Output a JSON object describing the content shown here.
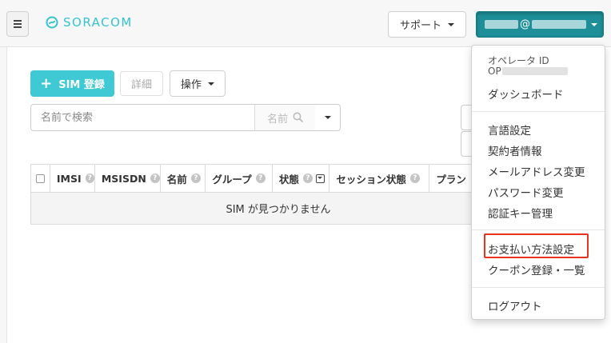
{
  "header": {
    "logo_text": "SORACOM",
    "support_label": "サポート",
    "user_email_visible": "@"
  },
  "toolbar": {
    "add_sim_label": "SIM 登録",
    "details_label": "詳細",
    "operations_label": "操作"
  },
  "search": {
    "placeholder": "名前で検索",
    "field_label": "名前"
  },
  "table": {
    "columns": [
      "IMSI",
      "MSISDN",
      "名前",
      "グループ",
      "状態",
      "セッション状態",
      "プラン"
    ],
    "empty_message": "SIM が見つかりません"
  },
  "user_menu": {
    "operator_id_label": "オペレータ ID",
    "operator_id_prefix": "OP",
    "dashboard": "ダッシュボード",
    "items_group1": [
      "言語設定",
      "契約者情報",
      "メールアドレス変更",
      "パスワード変更",
      "認証キー管理"
    ],
    "items_group2": [
      "お支払い方法設定",
      "クーポン登録・一覧"
    ],
    "logout": "ログアウト"
  },
  "colors": {
    "brand": "#3ec9d4",
    "user_button": "#1e8f98",
    "highlight": "#e8341c"
  }
}
